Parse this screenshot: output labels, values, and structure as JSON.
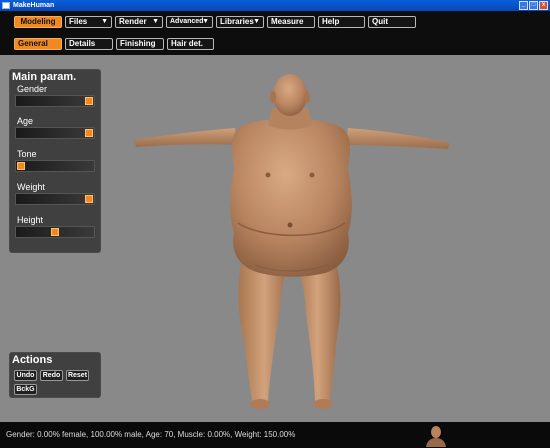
{
  "window": {
    "title": "MakeHuman",
    "minimize": "_",
    "maximize": "□",
    "close": "x"
  },
  "menubar": {
    "items": [
      {
        "label": "Modeling",
        "active": true
      },
      {
        "label": "Files",
        "dropdown": true
      },
      {
        "label": "Render",
        "dropdown": true
      },
      {
        "label": "Advanced",
        "dropdown": true
      },
      {
        "label": "Libraries",
        "dropdown": true
      },
      {
        "label": "Measure"
      },
      {
        "label": "Help"
      },
      {
        "label": "Quit"
      }
    ],
    "dropdown_glyph": "▼"
  },
  "subbar": {
    "tabs": [
      {
        "label": "General",
        "active": true
      },
      {
        "label": "Details"
      },
      {
        "label": "Finishing"
      },
      {
        "label": "Hair det."
      }
    ]
  },
  "main_param": {
    "title": "Main param.",
    "sliders": [
      {
        "label": "Gender",
        "value": 1.0
      },
      {
        "label": "Age",
        "value": 1.0
      },
      {
        "label": "Tone",
        "value": 0.0
      },
      {
        "label": "Weight",
        "value": 1.0
      },
      {
        "label": "Height",
        "value": 0.5
      }
    ]
  },
  "actions": {
    "title": "Actions",
    "buttons": [
      "Undo",
      "Redo",
      "Reset",
      "BckG"
    ]
  },
  "status": {
    "text": "Gender: 0.00% female, 100.00% male, Age: 70, Muscle: 0.00%, Weight: 150.00%"
  },
  "colors": {
    "accent": "#f08a20",
    "viewport": "#898989",
    "bar": "#0d0d0d",
    "skin": "#c69670"
  }
}
